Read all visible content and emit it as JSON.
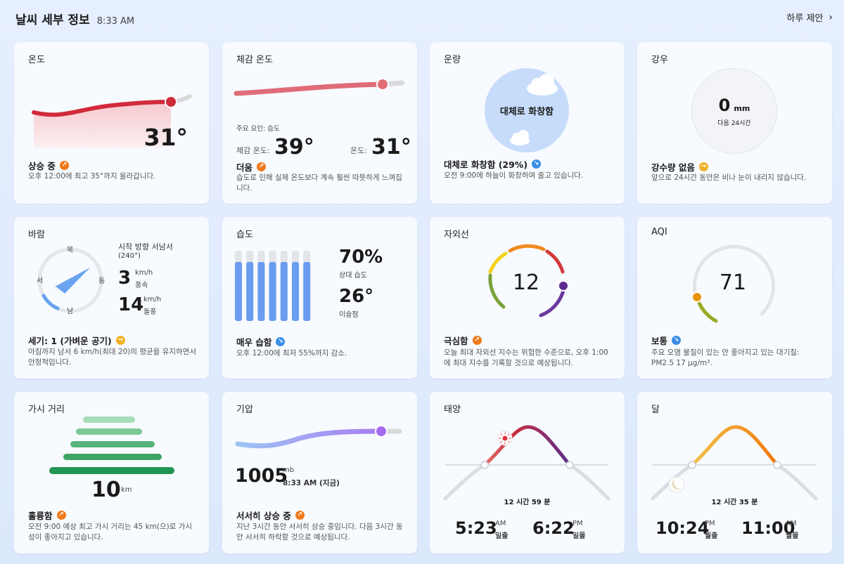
{
  "header": {
    "title": "날씨 세부 정보",
    "time": "8:33 AM",
    "suggest": "하루 제안",
    "suggest_icon": "chevron-right-icon"
  },
  "temp": {
    "title": "온도",
    "value": "31°",
    "status": "상승 중",
    "desc": "오후 12:00에 최고 35°까지 올라갑니다."
  },
  "feels": {
    "title": "체감 온도",
    "factor": "주요 요인: 습도",
    "feels_label": "체감 온도:",
    "feels_value": "39°",
    "temp_label": "온도:",
    "temp_value": "31°",
    "status": "더움",
    "desc": "습도로 인해 실제 온도보다 계속 훨씬 따뜻하게 느껴집니다."
  },
  "cloud": {
    "title": "운량",
    "center": "대체로 화창함",
    "status": "대체로 화창함 (29%)",
    "desc": "오전 9:00에 하늘이 화창하며 줄고 있습니다."
  },
  "rain": {
    "title": "강우",
    "value": "0",
    "unit": "mm",
    "sub": "다음 24시간",
    "status": "강수량 없음",
    "desc": "앞으로 24시간 동안은 비나 눈이 내리지 않습니다."
  },
  "wind": {
    "title": "바람",
    "dir_north": "북",
    "dir_south": "남",
    "dir_west": "서",
    "dir_east": "동",
    "from": "시작 방향 서남서",
    "deg": "(240°)",
    "speed": "3",
    "speed_unit": "km/h",
    "speed_label": "풍속",
    "gust": "14",
    "gust_unit": "km/h",
    "gust_label": "돌풍",
    "status": "세기: 1 (가벼운 공기)",
    "desc": "아침까지 남서 6 km/h(최대 20)의 평균을 유지하면서 안정적입니다."
  },
  "humidity": {
    "title": "습도",
    "rel": "70%",
    "rel_label": "상대 습도",
    "dew": "26°",
    "dew_label": "이슬점",
    "status": "매우 습함",
    "desc": "오후 12:00에 최저 55%까지 감소.",
    "bars": [
      0.75,
      0.75,
      0.75,
      0.75,
      0.75,
      0.75,
      0.75
    ]
  },
  "uv": {
    "title": "자외선",
    "value": "12",
    "status": "극심함",
    "desc": "오늘 최대 자외선 지수는 위험한 수준으로, 오후 1:00에 최대 지수를 기록할 것으로 예상됩니다."
  },
  "aqi": {
    "title": "AQI",
    "value": "71",
    "status": "보통",
    "desc": "주요 오염 물질이 있는 안 좋아지고 있는 대기질: PM2.5 17 μg/m³."
  },
  "visibility": {
    "title": "가시 거리",
    "value": "10",
    "unit": "km",
    "status": "훌륭함",
    "desc": "오전 9:00 예상 최고 가시 거리는 45 km(으)로 가시성이 좋아지고 있습니다."
  },
  "pressure": {
    "title": "기압",
    "value": "1005",
    "unit": "mb",
    "time": "8:33 AM (지금)",
    "status": "서서히 상승 중",
    "desc": "지난 3시간 동안 서서히 상승 중입니다. 다음 3시간 동안 서서히 하락할 것으로 예상됩니다."
  },
  "sun": {
    "title": "태양",
    "duration": "12 시간 59 분",
    "rise_time": "5:23",
    "rise_ampm": "AM",
    "rise_label": "일출",
    "set_time": "6:22",
    "set_ampm": "PM",
    "set_label": "일몰"
  },
  "moon": {
    "title": "달",
    "duration": "12 시간 35 분",
    "rise_time": "10:24",
    "rise_ampm": "PM",
    "rise_label": "월출",
    "set_time": "11:00",
    "set_ampm": "AM",
    "set_label": "월몰"
  }
}
